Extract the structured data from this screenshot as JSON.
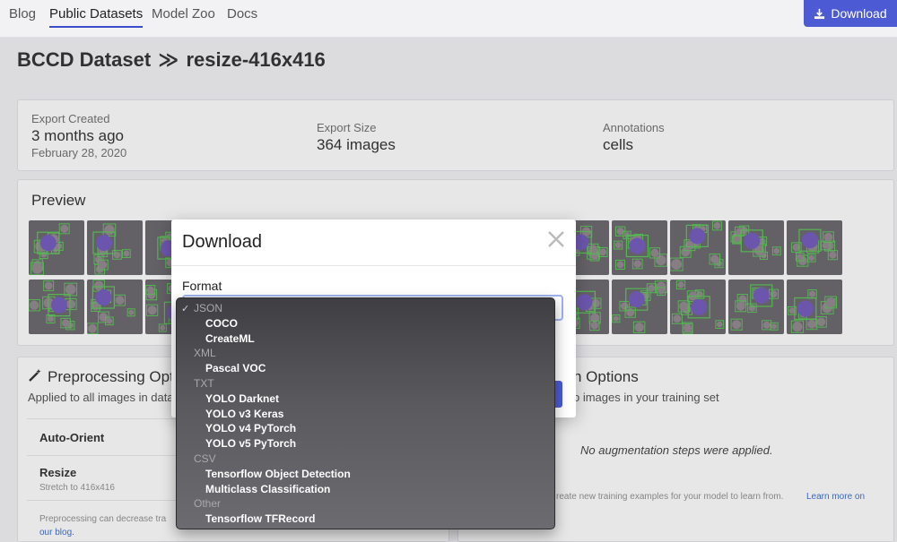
{
  "nav": {
    "links": [
      "Blog",
      "Public Datasets",
      "Model Zoo",
      "Docs"
    ],
    "active": "Public Datasets",
    "download_button": "Download"
  },
  "page": {
    "dataset": "BCCD Dataset",
    "version": "resize-416x416"
  },
  "info": {
    "export_created_label": "Export Created",
    "export_created_value": "3 months ago",
    "export_created_date": "February 28, 2020",
    "export_size_label": "Export Size",
    "export_size_value": "364 images",
    "annotations_label": "Annotations",
    "annotations_value": "cells"
  },
  "preview": {
    "title": "Preview"
  },
  "preprocessing": {
    "title": "Preprocessing Opt",
    "subtitle": "Applied to all images in data",
    "steps": [
      {
        "name": "Auto-Orient",
        "detail": ""
      },
      {
        "name": "Resize",
        "detail": "Stretch to 416x416"
      }
    ],
    "note": "Preprocessing can decrease tra",
    "note_link": "our blog."
  },
  "augmentation": {
    "title": "n Options",
    "subtitle": "o images in your training set",
    "empty": "No augmentation steps were applied.",
    "note": "reate new training examples for your model to learn from.",
    "note_link": "Learn more on"
  },
  "modal": {
    "title": "Download",
    "format_label": "Format",
    "selected": "COCO"
  },
  "dropdown": {
    "groups": [
      {
        "label": "JSON",
        "options": [
          "COCO",
          "CreateML"
        ]
      },
      {
        "label": "XML",
        "options": [
          "Pascal VOC"
        ]
      },
      {
        "label": "TXT",
        "options": [
          "YOLO Darknet",
          "YOLO v3 Keras",
          "YOLO v4 PyTorch",
          "YOLO v5 PyTorch"
        ]
      },
      {
        "label": "CSV",
        "options": [
          "Tensorflow Object Detection",
          "Multiclass Classification"
        ]
      },
      {
        "label": "Other",
        "options": [
          "Tensorflow TFRecord"
        ]
      }
    ]
  },
  "colors": {
    "accent": "#4c5bd4",
    "link": "#2e64c8",
    "thumb_bg": "#5e5c61",
    "box_green": "#4fc24a",
    "cell_purple": "#6a4fb8"
  }
}
